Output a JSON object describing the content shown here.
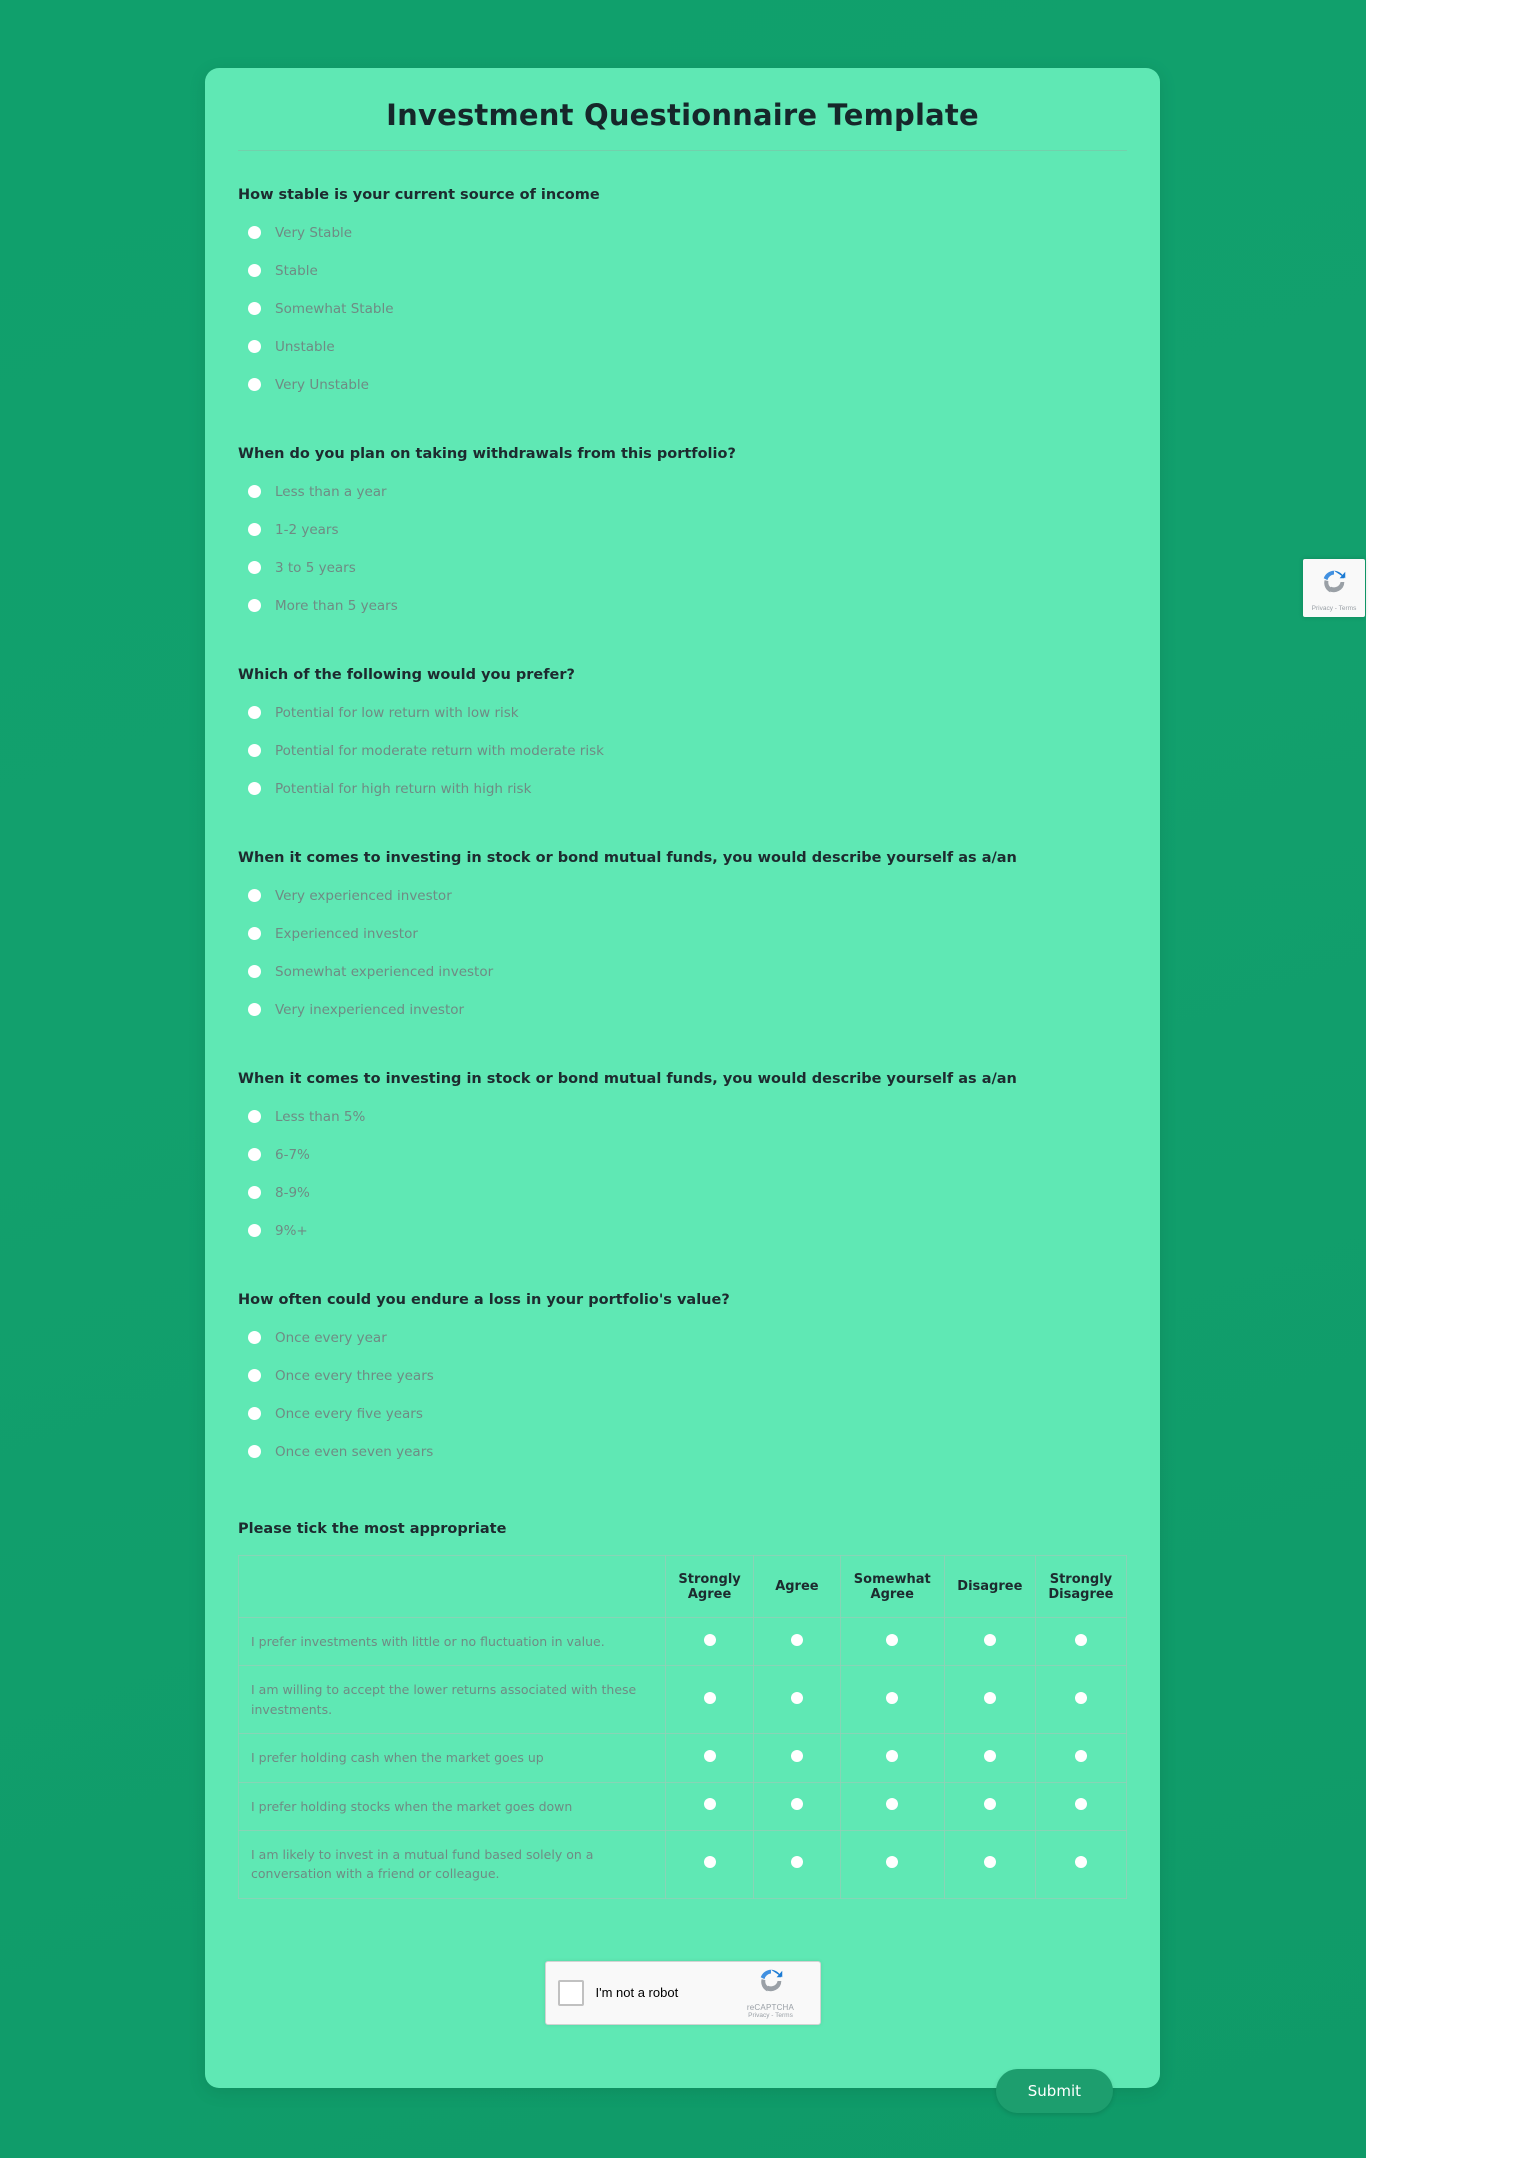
{
  "page": {
    "title": "Investment Questionnaire Template",
    "background_color": "#10a06c",
    "card_color": "#5fe8b4",
    "accent_color": "#1d9e6e"
  },
  "questions": [
    {
      "label": "How stable is your current source of income",
      "options": [
        "Very Stable",
        "Stable",
        "Somewhat Stable",
        "Unstable",
        "Very Unstable"
      ]
    },
    {
      "label": "When do you plan on taking withdrawals from this portfolio?",
      "options": [
        "Less than a year",
        "1-2 years",
        "3 to 5 years",
        "More than 5 years"
      ]
    },
    {
      "label": "Which of the following would you prefer?",
      "options": [
        "Potential for low return with low risk",
        "Potential for moderate return with moderate risk",
        "Potential for high return with high risk"
      ]
    },
    {
      "label": "When it comes to investing in stock or bond mutual funds, you would describe yourself as a/an",
      "options": [
        "Very experienced investor",
        "Experienced investor",
        "Somewhat experienced investor",
        "Very inexperienced investor"
      ]
    },
    {
      "label": "When it comes to investing in stock or bond mutual funds, you would describe yourself as a/an",
      "options": [
        "Less than 5%",
        "6-7%",
        "8-9%",
        "9%+"
      ]
    },
    {
      "label": "How often could you endure a loss in your portfolio's value?",
      "options": [
        "Once every year",
        "Once every three years",
        "Once every five years",
        "Once even seven years"
      ]
    }
  ],
  "matrix": {
    "label": "Please tick the most appropriate",
    "columns": [
      "Strongly Agree",
      "Agree",
      "Somewhat Agree",
      "Disagree",
      "Strongly Disagree"
    ],
    "rows": [
      "I prefer investments with little or no fluctuation in value.",
      "I am willing to accept the lower returns associated with these investments.",
      "I prefer holding cash when the market goes up",
      "I prefer holding stocks when the market goes down",
      "I am likely to invest in a mutual fund based solely on a conversation with a friend or colleague."
    ]
  },
  "recaptcha": {
    "checkbox_label": "I'm not a robot",
    "brand": "reCAPTCHA",
    "legal": "Privacy - Terms"
  },
  "badge": {
    "legal": "Privacy - Terms"
  },
  "submit": {
    "label": "Submit"
  }
}
